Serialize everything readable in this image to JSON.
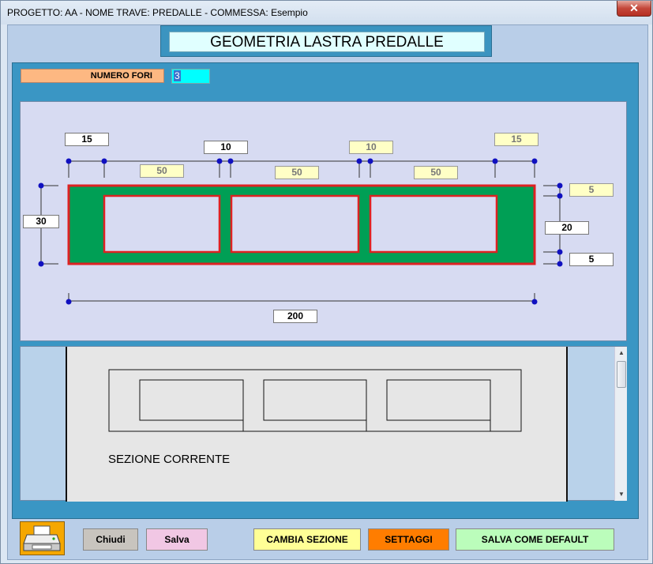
{
  "window": {
    "title": "PROGETTO: AA - NOME TRAVE: PREDALLE - COMMESSA: Esempio",
    "close_glyph": "✕"
  },
  "header": {
    "title": "GEOMETRIA LASTRA PREDALLE"
  },
  "form": {
    "numero_fori_label": "NUMERO FORI",
    "numero_fori_value": "3"
  },
  "dimensions": {
    "left_margin": "15",
    "gap_1": "10",
    "gap_2": "10",
    "right_margin": "15",
    "hole_1_width": "50",
    "hole_2_width": "50",
    "hole_3_width": "50",
    "total_height": "30",
    "top_cover": "5",
    "hole_height": "20",
    "bottom_cover": "5",
    "total_width": "200"
  },
  "section": {
    "label": "SEZIONE CORRENTE"
  },
  "colors": {
    "slab_fill": "#009f55",
    "hole_border": "#dd2222",
    "accent_blue": "#3a96c4"
  },
  "buttons": {
    "print_icon": "printer-icon",
    "chiudi": "Chiudi",
    "salva": "Salva",
    "cambia_sezione": "CAMBIA SEZIONE",
    "settaggi": "SETTAGGI",
    "salva_default": "SALVA COME DEFAULT"
  }
}
